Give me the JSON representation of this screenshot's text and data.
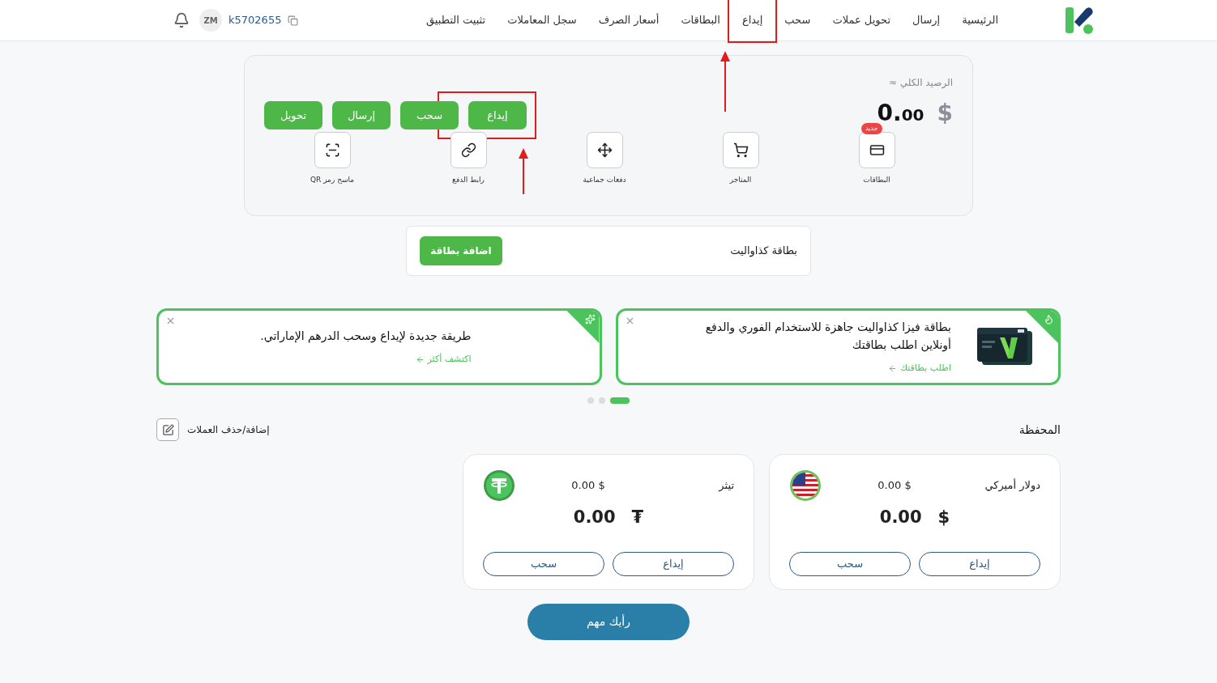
{
  "header": {
    "nav": [
      {
        "label": "الرئيسية",
        "highlighted": false
      },
      {
        "label": "إرسال",
        "highlighted": false
      },
      {
        "label": "تحويل عملات",
        "highlighted": false
      },
      {
        "label": "سحب",
        "highlighted": false
      },
      {
        "label": "إيداع",
        "highlighted": true
      },
      {
        "label": "البطاقات",
        "highlighted": false
      },
      {
        "label": "أسعار الصرف",
        "highlighted": false
      },
      {
        "label": "سجل المعاملات",
        "highlighted": false
      },
      {
        "label": "تثبيت التطبيق",
        "highlighted": false
      }
    ],
    "user_id": "k5702655",
    "avatar_initials": "ZM"
  },
  "balance_card": {
    "label": "الرصيد الكلي ≈",
    "currency": "$",
    "amount_whole": "0.",
    "amount_fraction": "00",
    "actions": [
      {
        "label": "إيداع",
        "highlighted": true
      },
      {
        "label": "سحب",
        "highlighted": false
      },
      {
        "label": "إرسال",
        "highlighted": false
      },
      {
        "label": "تحويل",
        "highlighted": false
      }
    ],
    "shortcuts": [
      {
        "kind": "cards",
        "label": "البطاقات",
        "badge": "جديد"
      },
      {
        "kind": "stores",
        "label": "المتاجر"
      },
      {
        "kind": "bulk",
        "label": "دفعات جماعية"
      },
      {
        "kind": "link",
        "label": "رابط الدفع"
      },
      {
        "kind": "qr",
        "label": "ماسح رمز QR"
      }
    ]
  },
  "card_strip": {
    "title": "بطاقة كذاواليت",
    "button": "اضافة بطاقة"
  },
  "banners": [
    {
      "kind": "fire",
      "text": "بطاقة فيزا كذاواليت جاهزة للاستخدام الفوري والدفع أونلاين اطلب بطاقتك",
      "link": "اطلب بطاقتك"
    },
    {
      "kind": "sparkle",
      "text": "طريقة جديدة لإيداع وسحب الدرهم الإماراتي.",
      "link": "اكتشف أكثر"
    }
  ],
  "carousel_dots": [
    {
      "selected": true
    },
    {
      "selected": false
    },
    {
      "selected": false
    }
  ],
  "wallet": {
    "title": "المحفظة",
    "manage": "إضافة/حذف العملات",
    "accounts": [
      {
        "kind": "usd",
        "name": "دولار أميركي",
        "small_balance": "0.00 $",
        "symbol": "$",
        "amount": "0.00",
        "deposit": "إيداع",
        "withdraw": "سحب"
      },
      {
        "kind": "usdt",
        "name": "تيثر",
        "small_balance": "0.00 $",
        "symbol": "₮",
        "amount": "0.00",
        "deposit": "إيداع",
        "withdraw": "سحب"
      }
    ]
  },
  "feedback_button": "رأيك مهم"
}
